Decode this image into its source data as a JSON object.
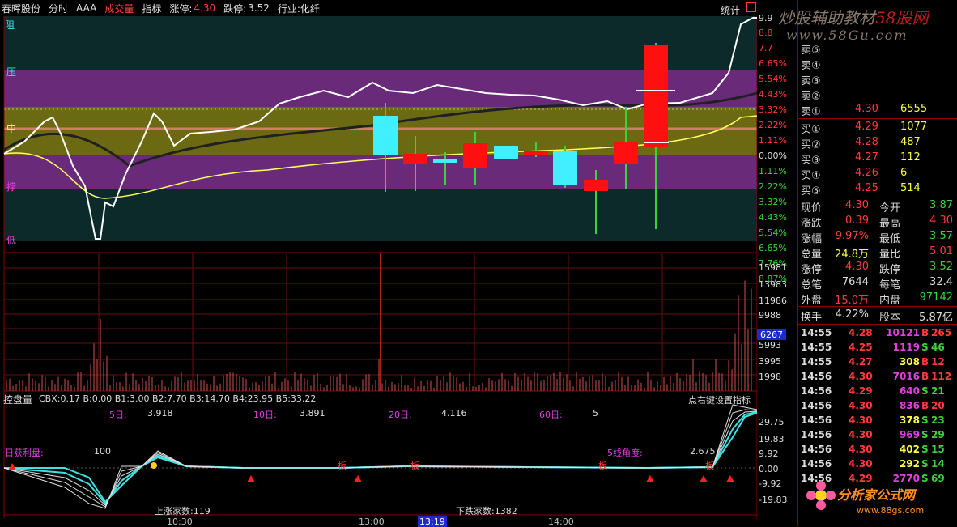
{
  "topbar": {
    "stock_name": "春晖股份",
    "items": [
      "分时",
      "AAA",
      "成交量",
      "指标"
    ],
    "limit_up_label": "涨停:",
    "limit_up_value": "4.30",
    "limit_down_label": "跌停:",
    "limit_down_value": "3.52",
    "industry": "行业:化纤",
    "stats_label": "统计",
    "close_box": "口"
  },
  "watermark": {
    "title": "炒股辅助教材",
    "title_num": "58股网",
    "url": "www.58Gu.com",
    "bottom_title": "分析家公式网",
    "bottom_url": "www.88gs.com"
  },
  "price_axis": {
    "top_value": "9.9",
    "labels": [
      {
        "t": "8.8",
        "c": "red"
      },
      {
        "t": "7.7",
        "c": "red"
      },
      {
        "t": "6.65%",
        "c": "red"
      },
      {
        "t": "5.54%",
        "c": "red"
      },
      {
        "t": "4.43%",
        "c": "red"
      },
      {
        "t": "3.32%",
        "c": "red"
      },
      {
        "t": "2.22%",
        "c": "red"
      },
      {
        "t": "1.11%",
        "c": "red"
      },
      {
        "t": "0.00%",
        "c": "white"
      },
      {
        "t": "1.11%",
        "c": "green"
      },
      {
        "t": "2.22%",
        "c": "green"
      },
      {
        "t": "3.32%",
        "c": "green"
      },
      {
        "t": "4.43%",
        "c": "green"
      },
      {
        "t": "5.54%",
        "c": "green"
      },
      {
        "t": "6.65%",
        "c": "green"
      },
      {
        "t": "7.76%",
        "c": "green"
      },
      {
        "t": "8.87%",
        "c": "green"
      }
    ],
    "zone_labels": [
      "阻",
      "压",
      "中",
      "撑",
      "低"
    ]
  },
  "volume_axis": {
    "labels": [
      "15981",
      "13983",
      "11986",
      "9988",
      "7990",
      "5993",
      "3995",
      "1998"
    ],
    "current": "6267"
  },
  "indicator": {
    "title": "控盘量",
    "params": "CBX:0.17  B:0.00  B1:3.00  B2:7.70  B3:14.70  B4:23.95  B5:33.22",
    "right_hint": "点右键设置指标",
    "day5_label": "5日:",
    "day5_value": "3.918",
    "day10_label": "10日:",
    "day10_value": "3.891",
    "day20_label": "20日:",
    "day20_value": "4.116",
    "day60_label": "60日:",
    "day60_value": "5",
    "profit_label": "日获利盘:",
    "profit_value": "100",
    "angle_label": "5线角度:",
    "angle_value": "2.675",
    "up_count": "上涨家数:119",
    "down_count": "下跌家数:1382",
    "axis": [
      "29.75",
      "19.83",
      "9.92",
      "0.00",
      "-9.92",
      "-19.83"
    ],
    "ban_marks": [
      "板",
      "板",
      "板",
      "板"
    ]
  },
  "time_axis": [
    "10:30",
    "13:00",
    "13:19",
    "14:00"
  ],
  "order_book": {
    "sell": [
      {
        "label": "卖⑤",
        "price": "",
        "vol": ""
      },
      {
        "label": "卖④",
        "price": "",
        "vol": ""
      },
      {
        "label": "卖③",
        "price": "",
        "vol": ""
      },
      {
        "label": "卖②",
        "price": "",
        "vol": ""
      },
      {
        "label": "卖①",
        "price": "4.30",
        "vol": "6555"
      }
    ],
    "buy": [
      {
        "label": "买①",
        "price": "4.29",
        "vol": "1077"
      },
      {
        "label": "买②",
        "price": "4.28",
        "vol": "487"
      },
      {
        "label": "买③",
        "price": "4.27",
        "vol": "112"
      },
      {
        "label": "买④",
        "price": "4.26",
        "vol": "6"
      },
      {
        "label": "买⑤",
        "price": "4.25",
        "vol": "514"
      }
    ]
  },
  "quote": [
    {
      "l1": "现价",
      "v1": "4.30",
      "c1": "red",
      "l2": "今开",
      "v2": "3.87",
      "c2": "green"
    },
    {
      "l1": "涨跌",
      "v1": "0.39",
      "c1": "red",
      "l2": "最高",
      "v2": "4.30",
      "c2": "red"
    },
    {
      "l1": "涨幅",
      "v1": "9.97%",
      "c1": "red",
      "l2": "最低",
      "v2": "3.57",
      "c2": "green"
    },
    {
      "l1": "总量",
      "v1": "24.8万",
      "c1": "yellow",
      "l2": "量比",
      "v2": "5.01",
      "c2": "red"
    },
    {
      "l1": "涨停",
      "v1": "4.30",
      "c1": "red",
      "l2": "跌停",
      "v2": "3.52",
      "c2": "green"
    },
    {
      "l1": "总笔",
      "v1": "7644",
      "c1": "white",
      "l2": "每笔",
      "v2": "32.4",
      "c2": "white"
    },
    {
      "l1": "外盘",
      "v1": "15.0万",
      "c1": "red",
      "l2": "内盘",
      "v2": "97142",
      "c2": "green"
    },
    {
      "l1": "换手",
      "v1": "4.22%",
      "c1": "white",
      "l2": "股本",
      "v2": "5.87亿",
      "c2": "white"
    }
  ],
  "ticks": [
    {
      "time": "14:55",
      "price": "4.28",
      "vol": "10121",
      "vc": "magenta",
      "bs": "B",
      "n": "265",
      "bc": "red"
    },
    {
      "time": "14:55",
      "price": "4.25",
      "vol": "1119",
      "vc": "magenta",
      "bs": "S",
      "n": "46",
      "bc": "green"
    },
    {
      "time": "14:55",
      "price": "4.27",
      "vol": "308",
      "vc": "yellow",
      "bs": "B",
      "n": "12",
      "bc": "red"
    },
    {
      "time": "14:56",
      "price": "4.30",
      "vol": "7016",
      "vc": "magenta",
      "bs": "B",
      "n": "112",
      "bc": "red"
    },
    {
      "time": "14:56",
      "price": "4.29",
      "vol": "640",
      "vc": "magenta",
      "bs": "S",
      "n": "21",
      "bc": "green"
    },
    {
      "time": "14:56",
      "price": "4.30",
      "vol": "836",
      "vc": "magenta",
      "bs": "B",
      "n": "20",
      "bc": "red"
    },
    {
      "time": "14:56",
      "price": "4.30",
      "vol": "378",
      "vc": "yellow",
      "bs": "S",
      "n": "23",
      "bc": "green"
    },
    {
      "time": "14:56",
      "price": "4.30",
      "vol": "969",
      "vc": "magenta",
      "bs": "S",
      "n": "29",
      "bc": "green"
    },
    {
      "time": "14:56",
      "price": "4.30",
      "vol": "402",
      "vc": "yellow",
      "bs": "S",
      "n": "15",
      "bc": "green"
    },
    {
      "time": "14:56",
      "price": "4.30",
      "vol": "292",
      "vc": "yellow",
      "bs": "S",
      "n": "14",
      "bc": "green"
    },
    {
      "time": "14:56",
      "price": "4.29",
      "vol": "2770",
      "vc": "magenta",
      "bs": "S",
      "n": "69",
      "bc": "green"
    }
  ]
}
